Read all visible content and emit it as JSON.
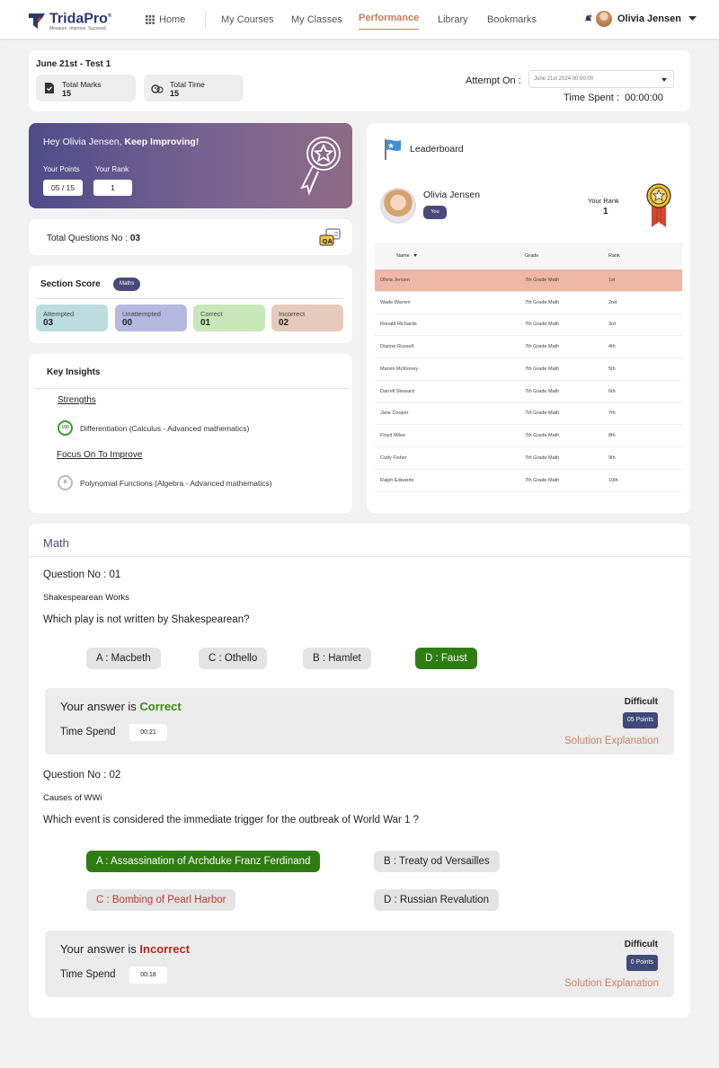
{
  "brand": {
    "name": "TridaPro",
    "reg": "®",
    "tagline": "Measure. Improve. Succeed."
  },
  "nav": {
    "home": "Home",
    "items": [
      "My Courses",
      "My Classes",
      "Performance",
      "Library",
      "Bookmarks"
    ],
    "active": "Performance",
    "user_name": "Olivia Jensen"
  },
  "test": {
    "title": "June 21st -  Test 1",
    "total_marks_label": "Total Marks",
    "total_marks": "15",
    "total_time_label": "Total Time",
    "total_time": "15",
    "attempt_label": "Attempt On :",
    "attempt_value": "June 21st  2024  00:00:00",
    "time_spent_label": "Time Spent :",
    "time_spent": "00:00:00"
  },
  "greeting": {
    "hello": "Hey Olivia Jensen, ",
    "emphasis": "Keep Improving!",
    "points_label": "Your Points",
    "points": "05 / 15",
    "rank_label": "Your Rank",
    "rank": "1"
  },
  "total_questions": {
    "label": "Total Questions No : ",
    "value": "03",
    "icon": "qa-icon"
  },
  "section_score": {
    "title": "Section Score",
    "subject": "Maths",
    "boxes": [
      {
        "label": "Attempted",
        "value": "03",
        "color": "#bcdcde"
      },
      {
        "label": "Unattempted",
        "value": "00",
        "color": "#b6b9df"
      },
      {
        "label": "Correct",
        "value": "01",
        "color": "#c8e8b9"
      },
      {
        "label": "Incorrect",
        "value": "02",
        "color": "#e6cbbc"
      }
    ]
  },
  "insights": {
    "title": "Key Insights",
    "strengths_label": "Strengths",
    "strength_score": "100",
    "strength_item": "Differentiation (Calculus - Advanced mathematics)",
    "focus_label": "Focus On To Improve",
    "focus_score": "0",
    "focus_item": "Polynomial Functions (Algebra - Advanced mathematics)"
  },
  "leaderboard": {
    "title": "Leaderboard",
    "me_name": "Olivia Jensen",
    "you_label": "You",
    "your_rank_label": "Your Rank",
    "your_rank": "1",
    "columns": [
      "Name",
      "Grade",
      "Rank"
    ],
    "rows": [
      {
        "name": "Olivia Jensen",
        "grade": "7th Grade Math",
        "rank": "1st"
      },
      {
        "name": "Wade Warren",
        "grade": "7th Grade Math",
        "rank": "2nd"
      },
      {
        "name": "Ronald Richards",
        "grade": "7th Grade Math",
        "rank": "3rd"
      },
      {
        "name": "Dianne Russell",
        "grade": "7th Grade Math",
        "rank": "4th"
      },
      {
        "name": "Marvin McKinney",
        "grade": "7th Grade Math",
        "rank": "5th"
      },
      {
        "name": "Darrell Steward",
        "grade": "7th Grade Math",
        "rank": "6th"
      },
      {
        "name": "Jane Cooper",
        "grade": "7th Grade Math",
        "rank": "7th"
      },
      {
        "name": "Floyd Miles",
        "grade": "7th Grade Math",
        "rank": "8th"
      },
      {
        "name": "Cody Fisher",
        "grade": "7th Grade Math",
        "rank": "9th"
      },
      {
        "name": "Ralph Edwards",
        "grade": "7th Grade Math",
        "rank": "10th"
      }
    ]
  },
  "math": {
    "title": "Math",
    "questions": [
      {
        "number": "Question No : 01",
        "topic": "Shakespearean Works",
        "text": "Which play is not written by Shakespearean?",
        "options": [
          "A : Macbeth",
          "C : Othello",
          "B : Hamlet",
          "D : Faust"
        ],
        "answer_prefix": "Your answer is ",
        "result": "Correct",
        "time_label": "Time Spend",
        "time": "00:21",
        "difficulty": "Difficult",
        "points": "05 Points",
        "solution": "Solution Explanation"
      },
      {
        "number": "Question No : 02",
        "topic": "Causes of WWi",
        "text": "Which event is considered the immediate trigger for the outbreak of World War 1 ?",
        "options": [
          "A : Assassination of Archduke Franz Ferdinand",
          "B : Treaty od Versailles",
          "C : Bombing of Pearl Harbor",
          "D : Russian Revalution"
        ],
        "answer_prefix": "Your answer is ",
        "result": "Incorrect",
        "time_label": "Time Spend",
        "time": "00:18",
        "difficulty": "Difficult",
        "points": "0 Points",
        "solution": "Solution Explanation"
      }
    ]
  },
  "colors": {
    "accent": "#4a4a7a",
    "active_nav": "#c77a5a",
    "correct": "#2e7d12",
    "incorrect": "#c0261b",
    "highlight_row": "#efb7a6"
  }
}
